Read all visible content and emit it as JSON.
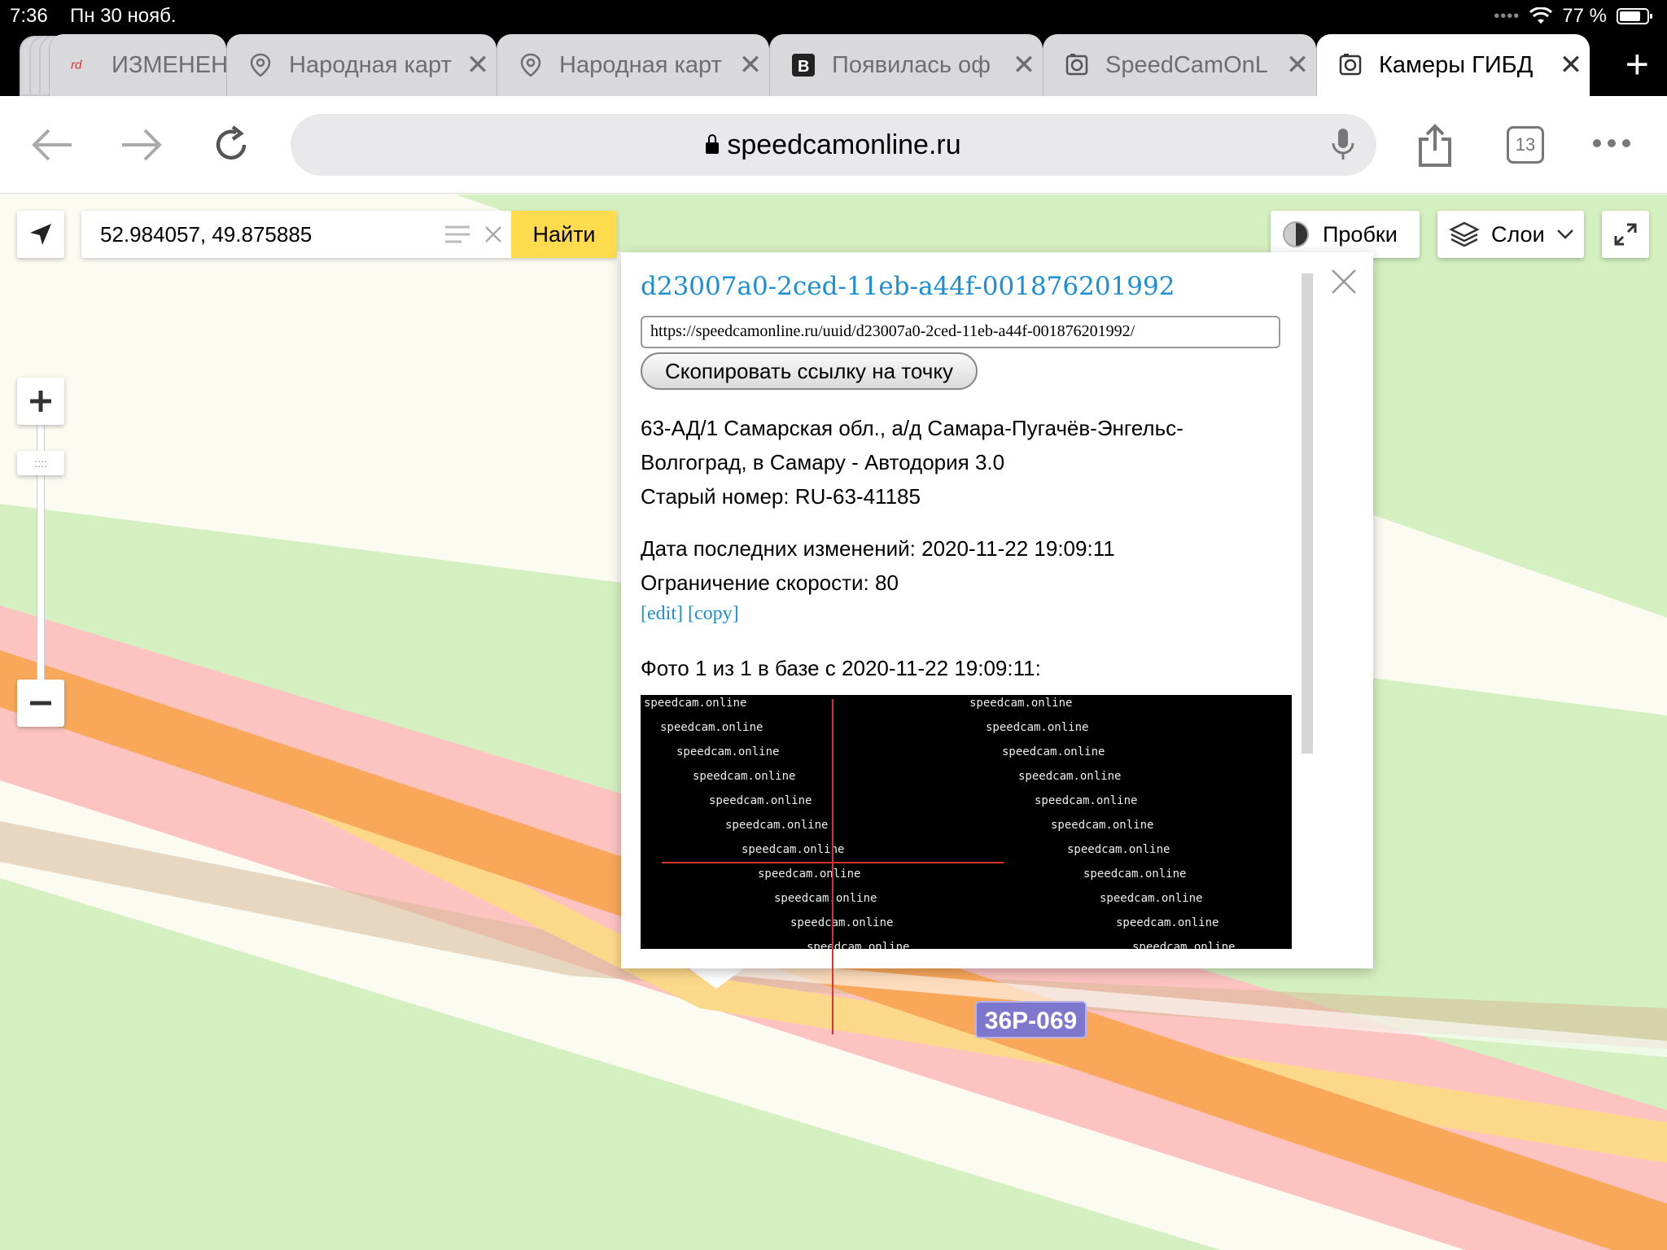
{
  "status": {
    "time": "7:36",
    "date": "Пн 30 нояб.",
    "battery": "77 %",
    "battery_level": 0.77
  },
  "tabs": [
    {
      "label": "ИЗМЕНЕН",
      "icon": "rd-logo-icon",
      "close": ""
    },
    {
      "label": "Народная карт",
      "icon": "location-pin-icon",
      "close": "✕"
    },
    {
      "label": "Народная карт",
      "icon": "location-pin-icon",
      "close": "✕"
    },
    {
      "label": "Появилась оф",
      "icon": "b-logo-icon",
      "close": "✕"
    },
    {
      "label": "SpeedCamOnL",
      "icon": "speedcam-site-icon",
      "close": "✕"
    },
    {
      "label": "Камеры ГИБД",
      "icon": "speedcam-site-icon",
      "close": "✕"
    }
  ],
  "new_tab_label": "+",
  "address": {
    "url": "speedcamonline.ru",
    "tab_count": "13"
  },
  "map": {
    "search_value": "52.984057, 49.875885",
    "search_button": "Найти",
    "traffic_label": "Пробки",
    "layers_label": "Слои",
    "zoom_handle": "::::",
    "road_label": "36Р-069"
  },
  "balloon": {
    "uuid": "d23007a0-2ced-11eb-a44f-001876201992",
    "link_url": "https://speedcamonline.ru/uuid/d23007a0-2ced-11eb-a44f-001876201992/",
    "copy_button": "Скопировать ссылку на точку",
    "description_line1": "63-АД/1 Самарская обл., а/д Самара-Пугачёв-Энгельс-",
    "description_line2": "Волгоград, в Самару - Автодория 3.0",
    "old_number": "Старый номер: RU-63-41185",
    "last_modified": "Дата последних изменений: 2020-11-22 19:09:11",
    "speed_limit": "Ограничение скорости: 80",
    "edit_link": "[edit]",
    "copy_link": "[copy]",
    "photo_caption": "Фото 1 из 1 в базе с 2020-11-22 19:09:11:",
    "watermark": "speedcam.online"
  },
  "colors": {
    "map_green": "#d5f0c0",
    "map_red": "#fcc3c0",
    "road_orange": "#f9a85a",
    "road_yellow": "#fcd98a",
    "search_button": "#ffdb4d",
    "link_blue": "#1a8fd8",
    "road_label": "#7e77ce"
  }
}
